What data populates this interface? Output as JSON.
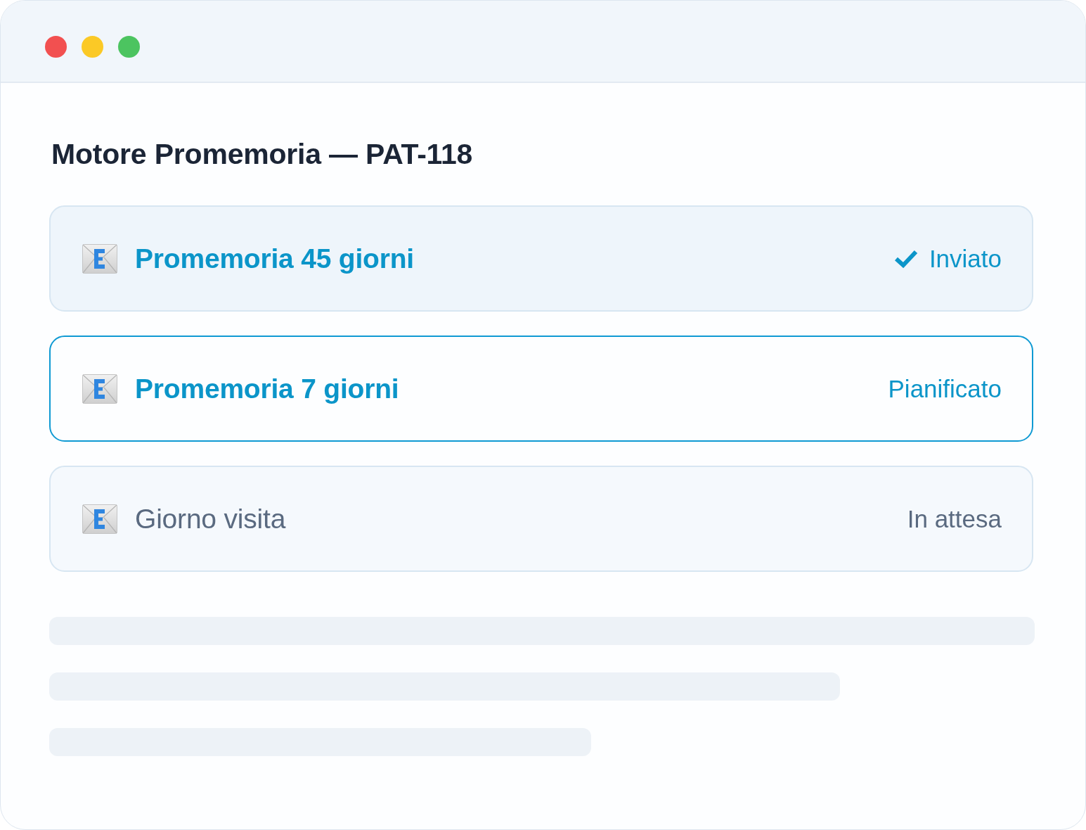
{
  "window": {
    "controls": [
      {
        "color": "#f25050"
      },
      {
        "color": "#fbc926"
      },
      {
        "color": "#4cc460"
      }
    ]
  },
  "title": "Motore Promemoria — PAT-118",
  "reminders": [
    {
      "label": "Promemoria 45 giorni",
      "status": "Inviato",
      "kind": "sent",
      "selected": false
    },
    {
      "label": "Promemoria 7 giorni",
      "status": "Pianificato",
      "kind": "scheduled",
      "selected": true
    },
    {
      "label": "Giorno visita",
      "status": "In attesa",
      "kind": "pending",
      "selected": false
    }
  ]
}
